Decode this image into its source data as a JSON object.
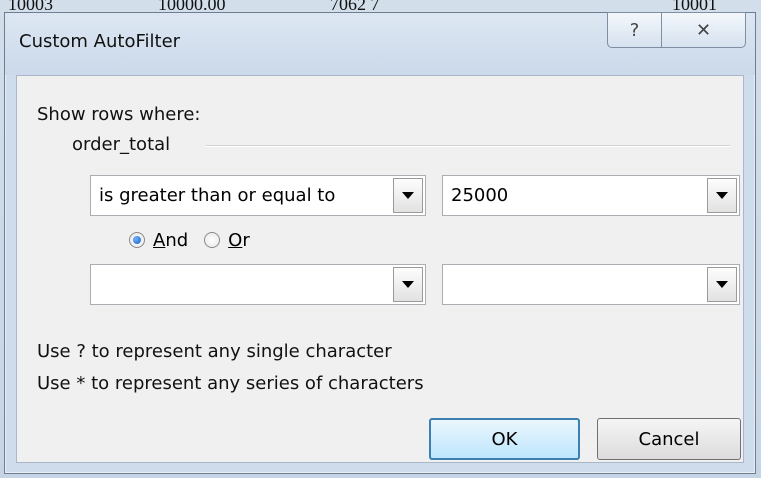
{
  "background": {
    "cells": [
      "10003",
      "10000.00",
      "7062 7",
      "10001"
    ]
  },
  "dialog": {
    "title": "Custom AutoFilter",
    "help_glyph": "?",
    "close_glyph": "✕",
    "show_rows_label": "Show rows where:",
    "field_name": "order_total",
    "condition1": {
      "operator": "is greater than or equal to",
      "value": "25000"
    },
    "logic": {
      "and_label": "And",
      "or_label": "Or",
      "selected": "And"
    },
    "condition2": {
      "operator": "",
      "value": ""
    },
    "hint1": "Use ? to represent any single character",
    "hint2": "Use * to represent any series of characters",
    "ok_label": "OK",
    "cancel_label": "Cancel"
  },
  "icons": {
    "help": "help-icon",
    "close": "close-icon",
    "dropdown": "chevron-down-icon"
  }
}
